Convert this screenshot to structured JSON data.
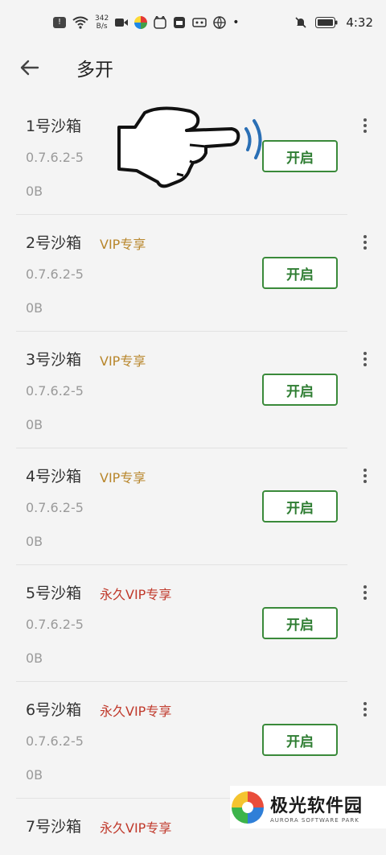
{
  "statusbar": {
    "net_speed_value": "342",
    "net_speed_unit": "B/s",
    "time": "4:32"
  },
  "header": {
    "title": "多开"
  },
  "sandboxes": [
    {
      "name": "1号沙箱",
      "tag": "",
      "version": "0.7.6.2-5",
      "size": "0B",
      "button": "开启"
    },
    {
      "name": "2号沙箱",
      "tag": "VIP专享",
      "version": "0.7.6.2-5",
      "size": "0B",
      "button": "开启"
    },
    {
      "name": "3号沙箱",
      "tag": "VIP专享",
      "version": "0.7.6.2-5",
      "size": "0B",
      "button": "开启"
    },
    {
      "name": "4号沙箱",
      "tag": "VIP专享",
      "version": "0.7.6.2-5",
      "size": "0B",
      "button": "开启"
    },
    {
      "name": "5号沙箱",
      "tag": "永久VIP专享",
      "version": "0.7.6.2-5",
      "size": "0B",
      "button": "开启"
    },
    {
      "name": "6号沙箱",
      "tag": "永久VIP专享",
      "version": "0.7.6.2-5",
      "size": "0B",
      "button": "开启"
    },
    {
      "name": "7号沙箱",
      "tag": "永久VIP专享",
      "version": "",
      "size": "",
      "button": ""
    }
  ],
  "colors": {
    "vip_tag": "#b8862b",
    "lifetime_vip_tag": "#c0392b",
    "button_green": "#2e7d32"
  },
  "watermark": {
    "title": "极光软件园",
    "subtitle": "AURORA SOFTWARE PARK"
  }
}
